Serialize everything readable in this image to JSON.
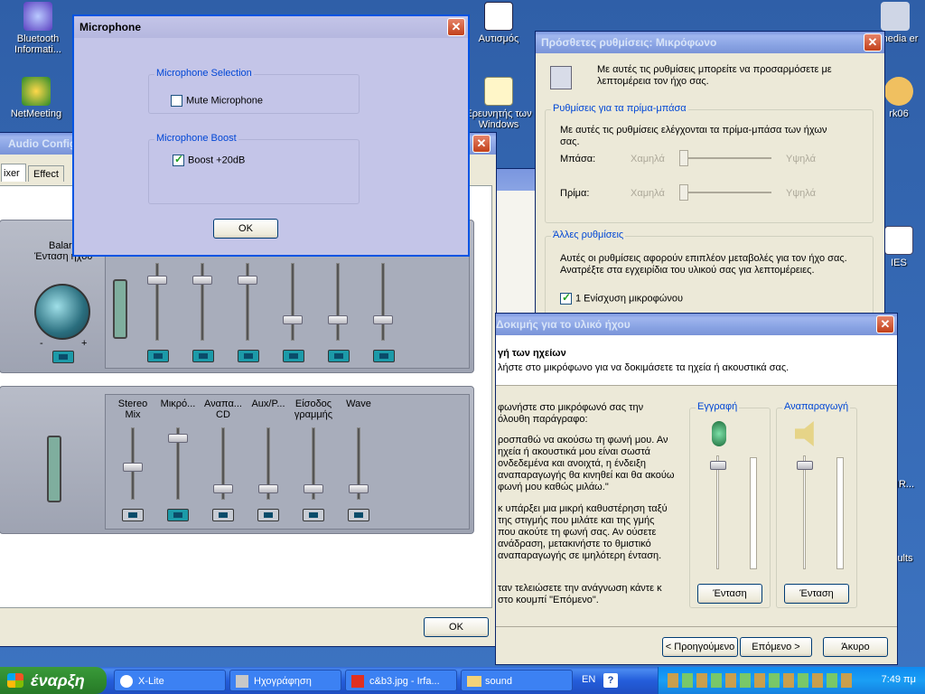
{
  "desktop": {
    "icons": [
      {
        "label": "Bluetooth Informati...",
        "icon": "bluetooth-icon"
      },
      {
        "label": "NetMeeting",
        "icon": "netmeeting-icon"
      },
      {
        "label": "Αυτισμός",
        "icon": "word-document-icon"
      },
      {
        "label": "Ερευνητής των Windows",
        "icon": "search-icon"
      },
      {
        "label": "ltimedia er",
        "icon": "multimedia-icon"
      },
      {
        "label": "rk06",
        "icon": "app-icon"
      },
      {
        "label": "IES",
        "icon": "document-icon"
      },
      {
        "label": "IR...",
        "icon": "app-icon"
      },
      {
        "label": "ults",
        "icon": "folder-icon"
      }
    ]
  },
  "mic_dialog": {
    "title": "Microphone",
    "selection_label": "Microphone Selection",
    "mute_label": "Mute Microphone",
    "mute_checked": false,
    "boost_group_label": "Microphone Boost",
    "boost_label": "Boost +20dB",
    "boost_checked": true,
    "ok_label": "OK"
  },
  "audio_config": {
    "title": "Audio Config",
    "tabs": [
      "ixer",
      "Effect"
    ],
    "balance_label": "Balar",
    "volume_label": "Ένταση ήχου",
    "minus": "-",
    "plus": "+",
    "rec_channels": [
      {
        "label": "Stereo Mix",
        "level": 0.45,
        "muted": false
      },
      {
        "label": "Μικρό...",
        "level": 0.9,
        "muted": true
      },
      {
        "label": "Αναπα... CD",
        "level": 0.1,
        "muted": false
      },
      {
        "label": "Aux/P...",
        "level": 0.1,
        "muted": false
      },
      {
        "label": "Είσοδος γραμμής",
        "level": 0.1,
        "muted": false
      },
      {
        "label": "Wave",
        "level": 0.1,
        "muted": false
      }
    ],
    "ok_label": "OK"
  },
  "advanced_dialog": {
    "title": "Πρόσθετες ρυθμίσεις: Μικρόφωνο",
    "intro": "Με αυτές τις ρυθμίσεις μπορείτε να προσαρμόσετε με λεπτομέρεια τον ήχο σας.",
    "tone_group": "Ρυθμίσεις για τα πρίμα-μπάσα",
    "tone_desc": "Με αυτές τις ρυθμίσεις ελέγχονται τα πρίμα-μπάσα των ήχων σας.",
    "bass_label": "Μπάσα:",
    "treble_label": "Πρίμα:",
    "low_label": "Χαμηλά",
    "high_label": "Υψηλά",
    "other_group": "Άλλες ρυθμίσεις",
    "other_desc": "Αυτές οι ρυθμίσεις αφορούν επιπλέον μεταβολές για τον ήχο σας. Ανατρέξτε στα εγχειρίδια του υλικού σας για λεπτομέρειες.",
    "boost_label": "1  Ενίσχυση μικροφώνου",
    "boost_checked": true
  },
  "wizard": {
    "title": "Δοκιμής για το υλικό ήχου",
    "heading": "γή των ηχείων",
    "subheading": "λήστε στο μικρόφωνο για να δοκιμάσετε τα ηχεία ή ακουστικά σας.",
    "instructions_1": "φωνήστε στο μικρόφωνό σας την όλουθη παράγραφο:",
    "instructions_2": "ροσπαθώ να ακούσω τη φωνή μου. Αν ηχεία ή ακουστικά μου είναι σωστά ονδεδεμένα και ανοιχτά, η ένδειξη αναπαραγωγής θα κινηθεί και θα ακούω φωνή μου καθώς μιλάω.\"",
    "instructions_3": "κ υπάρξει μια μικρή καθυστέρηση ταξύ της στιγμής που μιλάτε και της γμής που ακούτε τη φωνή σας. Αν ούσετε ανάδραση, μετακινήστε το θμιστικό αναπαραγωγής σε ιμηλότερη ένταση.",
    "instructions_4": "ταν τελειώσετε την ανάγνωση κάντε κ στο κουμπί \"Επόμενο\".",
    "record_label": "Εγγραφή",
    "playback_label": "Αναπαραγωγή",
    "record_level": 0.95,
    "playback_level": 0.95,
    "volume_btn": "Ένταση",
    "back_label": "< Προηγούμενο",
    "next_label": "Επόμενο >",
    "cancel_label": "Άκυρο"
  },
  "taskbar": {
    "start_label": "έναρξη",
    "buttons": [
      {
        "label": "X-Lite"
      },
      {
        "label": "Ηχογράφηση"
      },
      {
        "label": "c&b3.jpg - Irfa..."
      },
      {
        "label": "sound"
      }
    ],
    "lang": "EN",
    "time": "7:49 πμ"
  }
}
